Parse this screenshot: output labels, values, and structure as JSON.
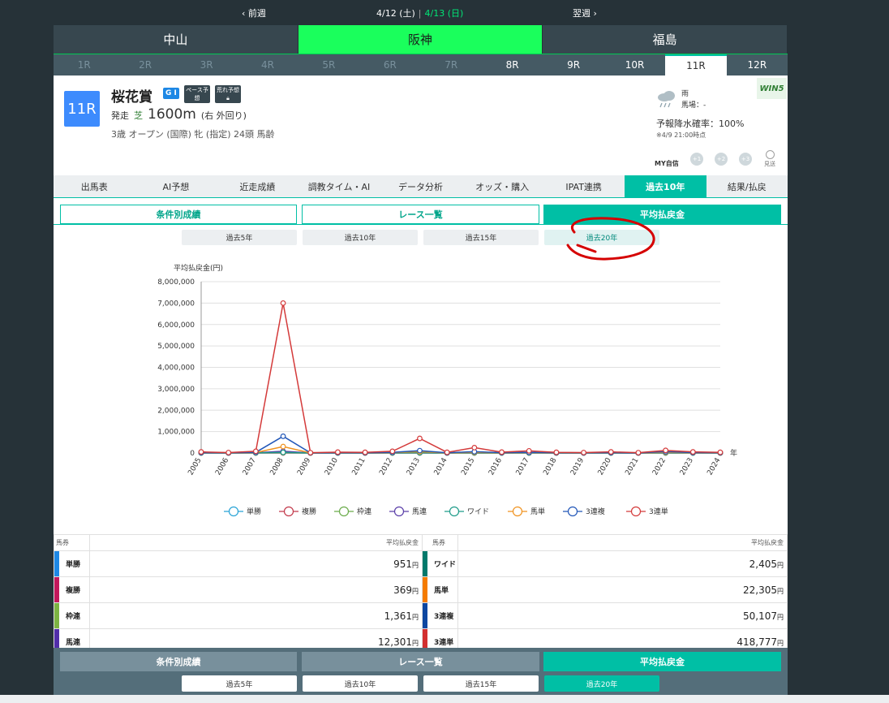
{
  "week_nav": {
    "prev": "前週",
    "next": "翌週",
    "date1": "4/12 (土)",
    "sep": "|",
    "date2": "4/13 (日)"
  },
  "venues": [
    "中山",
    "阪神",
    "福島"
  ],
  "races": [
    "1R",
    "2R",
    "3R",
    "4R",
    "5R",
    "6R",
    "7R",
    "8R",
    "9R",
    "10R",
    "11R",
    "12R"
  ],
  "race": {
    "badge": "11R",
    "name": "桜花賞",
    "grade": "G I",
    "pace_pred": "ペース予想",
    "rough_pred": "荒れ予想",
    "start_label": "発走",
    "surface": "芝",
    "distance": "1600m",
    "course": "(右 外回り)",
    "conditions": "3歳 オープン (国際) 牝 (指定) 24頭 馬齢"
  },
  "weather": {
    "condition": "雨",
    "track": "馬場：-",
    "rain_prob": "予報降水確率：100%",
    "forecast_time": "※4/9 21:00時点",
    "win5": "WIN5",
    "my_conf": "MY自信",
    "conf_levels": [
      "+1",
      "+2",
      "+3"
    ],
    "skip": "見送"
  },
  "section_tabs": [
    "出馬表",
    "AI予想",
    "近走成績",
    "調教タイム・AI",
    "データ分析",
    "オッズ・購入",
    "IPAT連携",
    "過去10年",
    "結果/払戻"
  ],
  "sub_tabs": [
    "条件別成績",
    "レース一覧",
    "平均払戻金"
  ],
  "period_tabs": [
    "過去5年",
    "過去10年",
    "過去15年",
    "過去20年"
  ],
  "chart_data": {
    "type": "line",
    "ylabel": "平均払戻金(円)",
    "xlabel": "年",
    "x": [
      "2005",
      "2006",
      "2007",
      "2008",
      "2009",
      "2010",
      "2011",
      "2012",
      "2013",
      "2014",
      "2015",
      "2016",
      "2017",
      "2018",
      "2019",
      "2020",
      "2021",
      "2022",
      "2023",
      "2024"
    ],
    "ylim": [
      0,
      8000000
    ],
    "yticks": [
      "0",
      "1,000,000",
      "2,000,000",
      "3,000,000",
      "4,000,000",
      "5,000,000",
      "6,000,000",
      "7,000,000",
      "8,000,000"
    ],
    "series": [
      {
        "name": "単勝",
        "color": "#29a3d6",
        "values": [
          1000,
          500,
          2000,
          4000,
          300,
          800,
          600,
          1000,
          2000,
          500,
          1500,
          800,
          1200,
          600,
          500,
          700,
          400,
          1100,
          900,
          600
        ]
      },
      {
        "name": "複勝",
        "color": "#c2384a",
        "values": [
          500,
          300,
          800,
          1500,
          200,
          400,
          300,
          500,
          1000,
          300,
          700,
          400,
          600,
          300,
          300,
          400,
          200,
          500,
          400,
          300
        ]
      },
      {
        "name": "枠連",
        "color": "#6aab4a",
        "values": [
          3000,
          1500,
          5000,
          15000,
          1000,
          2000,
          1500,
          3000,
          8000,
          1500,
          5000,
          2000,
          3000,
          1500,
          1000,
          2000,
          1000,
          4000,
          2500,
          1500
        ]
      },
      {
        "name": "馬連",
        "color": "#5a3ea8",
        "values": [
          5000,
          3000,
          10000,
          80000,
          2000,
          5000,
          3000,
          10000,
          30000,
          3000,
          15000,
          5000,
          10000,
          4000,
          3000,
          5000,
          2000,
          15000,
          8000,
          4000
        ]
      },
      {
        "name": "ワイド",
        "color": "#1f9c8a",
        "values": [
          1500,
          1000,
          3000,
          25000,
          800,
          1500,
          1000,
          3000,
          10000,
          1000,
          5000,
          1500,
          3000,
          1200,
          1000,
          1500,
          800,
          5000,
          2500,
          1200
        ]
      },
      {
        "name": "馬単",
        "color": "#f0921e",
        "values": [
          10000,
          5000,
          20000,
          300000,
          4000,
          10000,
          6000,
          20000,
          60000,
          6000,
          30000,
          10000,
          20000,
          8000,
          6000,
          10000,
          4000,
          30000,
          15000,
          8000
        ]
      },
      {
        "name": "3連複",
        "color": "#2257b8",
        "values": [
          15000,
          8000,
          30000,
          780000,
          5000,
          15000,
          10000,
          30000,
          110000,
          10000,
          60000,
          15000,
          30000,
          12000,
          8000,
          15000,
          6000,
          60000,
          20000,
          12000
        ]
      },
      {
        "name": "3連単",
        "color": "#d43a3a",
        "values": [
          50000,
          20000,
          80000,
          7000000,
          15000,
          40000,
          30000,
          80000,
          680000,
          30000,
          250000,
          40000,
          100000,
          30000,
          20000,
          50000,
          15000,
          120000,
          50000,
          30000
        ]
      }
    ]
  },
  "table": {
    "header": [
      "馬券",
      "平均払戻金",
      "馬券",
      "平均払戻金"
    ],
    "unit": "円",
    "rows": [
      {
        "l_name": "単勝",
        "l_val": "951",
        "l_color": "#1e88e5",
        "r_name": "ワイド",
        "r_val": "2,405",
        "r_color": "#00796b"
      },
      {
        "l_name": "複勝",
        "l_val": "369",
        "l_color": "#c2185b",
        "r_name": "馬単",
        "r_val": "22,305",
        "r_color": "#f57c00"
      },
      {
        "l_name": "枠連",
        "l_val": "1,361",
        "l_color": "#7cb342",
        "r_name": "3連複",
        "r_val": "50,107",
        "r_color": "#0d47a1"
      },
      {
        "l_name": "馬連",
        "l_val": "12,301",
        "l_color": "#512da8",
        "r_name": "3連単",
        "r_val": "418,777",
        "r_color": "#d32f2f"
      }
    ]
  }
}
